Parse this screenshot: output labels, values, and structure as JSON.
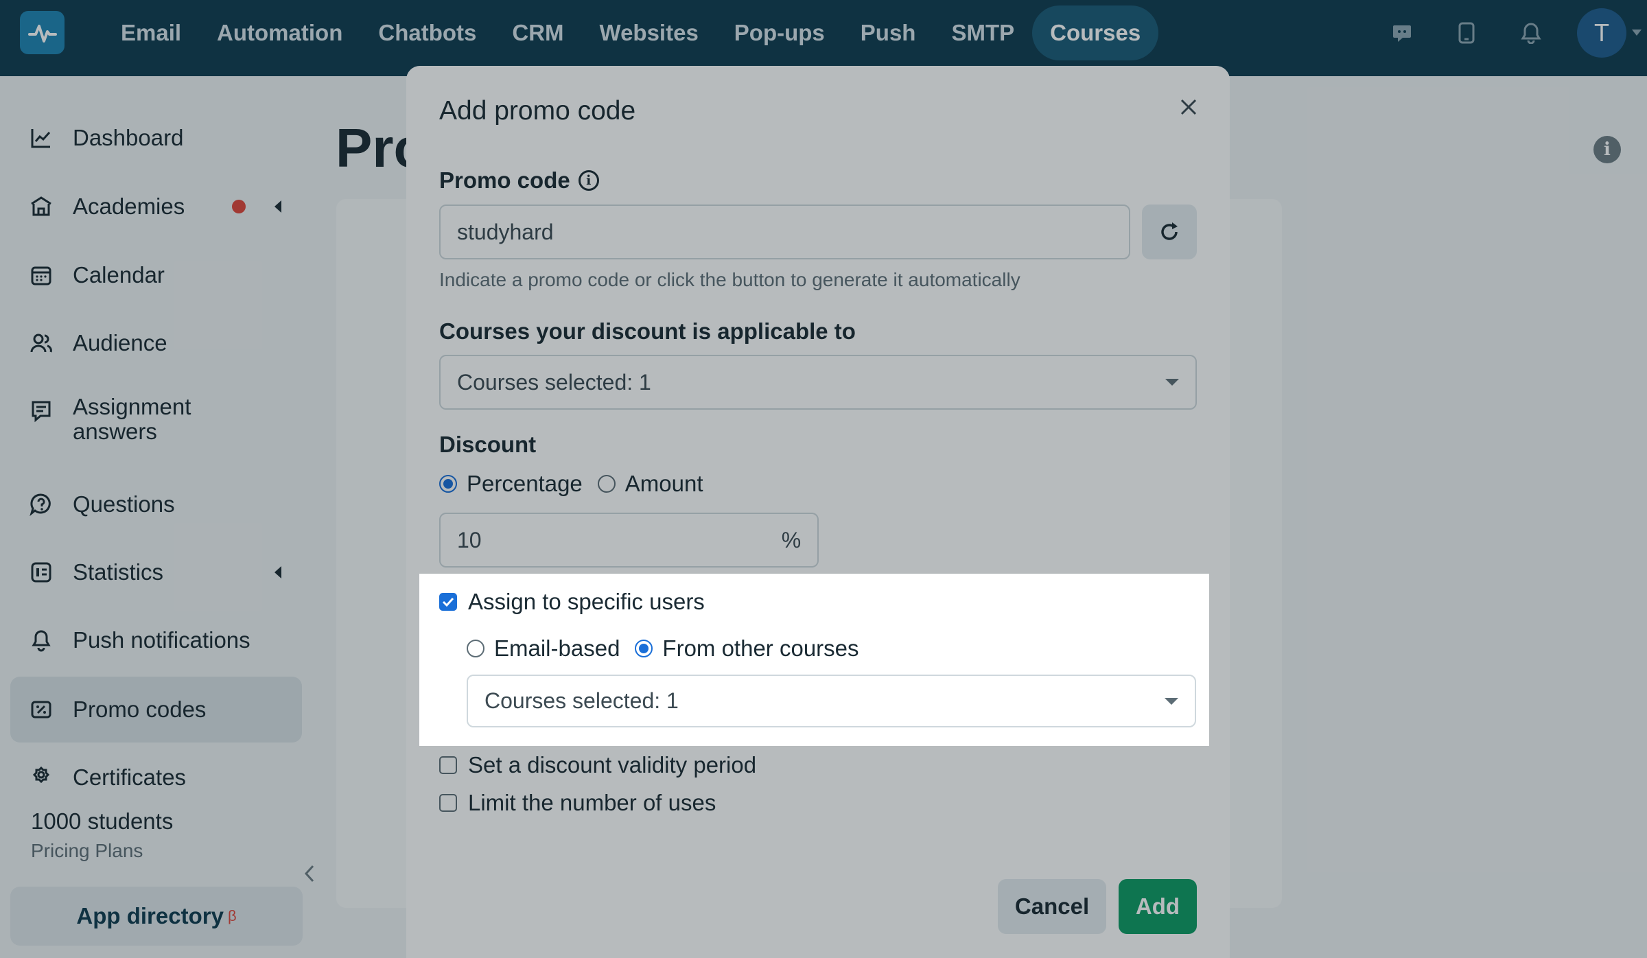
{
  "topnav": {
    "items": [
      "Email",
      "Automation",
      "Chatbots",
      "CRM",
      "Websites",
      "Pop-ups",
      "Push",
      "SMTP",
      "Courses"
    ],
    "active": "Courses",
    "avatar_letter": "T",
    "icons": [
      "logo-icon",
      "chat-icon",
      "mobile-icon",
      "bell-icon",
      "chevron-down-icon"
    ]
  },
  "sidebar": {
    "items": [
      {
        "label": "Dashboard",
        "icon": "chart-line-icon"
      },
      {
        "label": "Academies",
        "icon": "academy-icon"
      },
      {
        "label": "Calendar",
        "icon": "calendar-icon"
      },
      {
        "label": "Audience",
        "icon": "users-icon"
      },
      {
        "label": "Assignment",
        "label2": "answers",
        "icon": "assignment-icon"
      },
      {
        "label": "Questions",
        "icon": "question-bubble-icon"
      },
      {
        "label": "Statistics",
        "icon": "statistics-icon"
      },
      {
        "label": "Push notifications",
        "icon": "bell-icon"
      },
      {
        "label": "Promo codes",
        "icon": "promo-icon"
      },
      {
        "label": "Certificates",
        "icon": "certificate-icon"
      }
    ],
    "active": "Promo codes",
    "plan_title": "1000 students",
    "plan_sub": "Pricing Plans",
    "app_directory": "App directory",
    "beta": "β",
    "colors": {
      "badge": "#e0453a"
    }
  },
  "page": {
    "title_partial": "Pro"
  },
  "modal": {
    "title": "Add promo code",
    "promo_label": "Promo code",
    "promo_value": "studyhard",
    "promo_hint": "Indicate a promo code or click the button to generate it automatically",
    "courses_label": "Courses your discount is applicable to",
    "courses_value": "Courses selected: 1",
    "discount_label": "Discount",
    "discount_percentage": "Percentage",
    "discount_amount": "Amount",
    "discount_value": "10",
    "discount_unit": "%",
    "assign_label": "Assign to specific users",
    "email_based": "Email-based",
    "from_other": "From other courses",
    "assign_courses_value": "Courses selected: 1",
    "validity_label": "Set a discount validity period",
    "limit_label": "Limit the number of uses",
    "cancel": "Cancel",
    "add": "Add",
    "colors": {
      "primary": "#0d9b63",
      "accent": "#1a6fd8",
      "header": "#0f3b4f"
    }
  }
}
